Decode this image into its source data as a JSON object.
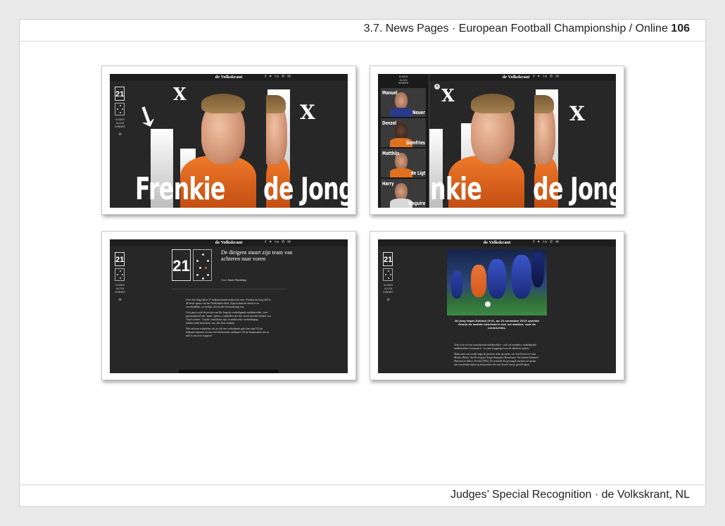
{
  "header": {
    "title": "3.7. News Pages · European Football Championship / Online",
    "page_number": "106"
  },
  "footer": {
    "credit": "Judges’ Special Recognition · de Volkskrant, NL"
  },
  "site": {
    "masthead": "de Volkskrant",
    "social_icons": "f ✦ in ✆ ✉",
    "player_number": "21",
    "side_label": [
      "KLIKEN",
      "ALLEN",
      "KENNER"
    ],
    "menu_icon": "≡"
  },
  "hero": {
    "first_name": "Frenkie",
    "last_name": "de Jong",
    "partial_first_name": "nkie",
    "mark": "X"
  },
  "players_panel": {
    "close_label": "×",
    "cards": [
      {
        "first": "Manuel",
        "last": "Neuer",
        "shirt_color": "#2a3a8a"
      },
      {
        "first": "Denzel",
        "last": "Dumfries",
        "shirt_color": "#e0701e"
      },
      {
        "first": "Matthijs",
        "last": "de Ligt",
        "shirt_color": "#e0701e"
      },
      {
        "first": "Harry",
        "last": "Maguire",
        "shirt_color": "#d9d9d9"
      }
    ]
  },
  "article": {
    "number": "21",
    "headline": "De dirigent stuurt zijn team van achteren naar voren",
    "byline_prefix": "Door",
    "byline_author": "Sam Planting",
    "paragraphs": [
      "Over één ding lijken 17 miljoen bondscoaches het eens: Frenkie de Jong (24) is de beste speler van het Nederlands elftal. Zijn technische talent is zo overduidelijk, zo sierlijk, dat slechts bewondering rest.",
      "Ooit gaat wordt de positie van De Jong als verdedigende middenvelder ‘zeer gezonzadeerd met ‘main’ spelers, voetballers die het vooral moeten hebben van ‘hard werken’. Goede controleurs zijn, in melkwerke voetbalbegrip, laatliewende keerchten, van alle flair ontdaan.",
      "Wie zal toen schuifelen, als je ook een verhaltende spits kan zijn? Of de briljante nummer tot met een beslissende steekpass? Of de buitenspeler die in snel is om af te stoppen?"
    ]
  },
  "photo_page": {
    "caption": "De Jong tegen Estland (5-0), op 19 november 2019 speelde Oranje de laatste interland in een vol stadion, voor de coronacrisis.",
    "paragraphs": [
      "Toch is de rol van controlerende middenvelder - ook wel zesmaker, verdedigende middenvelder of nummer 6 - nu juist weggelegd voor de allerbeste spelers.",
      "Maak maar een rondje langs de grootste clubs op aarde, van Toni Kroos tot Luka Modric (Real). Van De Jong tot Sergio Busquets (Barcelona). Van Joshua Kimmich (Bayern) tot Marco Verratti (PSG). De techniek die gevraagd van deze rol spelen met wisselende stijlen op hun posities die ook al meer dan je gewild lopen."
    ]
  }
}
